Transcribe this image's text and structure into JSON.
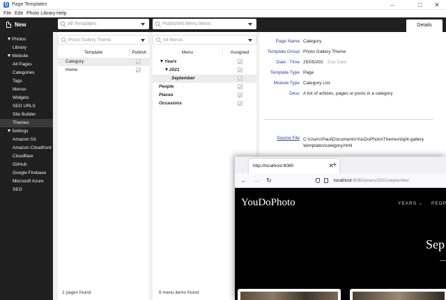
{
  "window": {
    "title": "Page Templates",
    "app_icon": "app-logo-icon"
  },
  "menubar": [
    "File",
    "Edit",
    "Photo Library",
    "Help"
  ],
  "toolbar": {
    "new_label": "New",
    "template_filter_placeholder": "All Templates",
    "menu_filter_placeholder": "Published Menu Items",
    "details_tab": "Details"
  },
  "sidebar": {
    "groups": [
      {
        "label": "Photos",
        "items": [
          "Library"
        ]
      },
      {
        "label": "Website",
        "items": [
          "All Pages",
          "Categories",
          "Tags",
          "Menus",
          "Widgets",
          "SEO URLS",
          "Site Builder",
          "Themes"
        ]
      },
      {
        "label": "Settings",
        "items": [
          "Amazon S3",
          "Amazon Cloudfront",
          "Cloudflare",
          "GitHub",
          "Google Firebase",
          "Microsoft Azure",
          "SEO"
        ]
      }
    ],
    "active_item": "Themes"
  },
  "templates_panel": {
    "search_placeholder": "Photo Gallery Theme",
    "columns": [
      "Template",
      "Publish"
    ],
    "rows": [
      {
        "name": "Category",
        "published": true,
        "selected": true
      },
      {
        "name": "Home",
        "published": true,
        "selected": false
      }
    ],
    "footer": "2 pages found"
  },
  "menus_panel": {
    "search_placeholder": "All Menus",
    "columns": [
      "Menu",
      "Assigned"
    ],
    "rows": [
      {
        "label": "Years",
        "level": 0,
        "expanded": true,
        "assigned": true
      },
      {
        "label": "2021",
        "level": 1,
        "expanded": true,
        "assigned": true
      },
      {
        "label": "September",
        "level": 2,
        "assigned": true,
        "selected": true
      },
      {
        "label": "People",
        "level": 0,
        "assigned": true
      },
      {
        "label": "Places",
        "level": 0,
        "assigned": true
      },
      {
        "label": "Occasions",
        "level": 0,
        "assigned": true
      }
    ],
    "footer": "6 menu items found"
  },
  "details": {
    "page_name_label": "Page Name",
    "page_name": "Category",
    "template_group_label": "Template Group",
    "template_group": "Photo Gallery Theme",
    "date_time_label": "Date - Time",
    "date": "25/05/202",
    "due_date_hint": "Due Date",
    "template_type_label": "Template Type",
    "template_type": "Page",
    "module_type_label": "Module Type",
    "module_type": "Category List",
    "desc_label": "Desc",
    "desc": "A list of articles, pages or posts in a category",
    "source_file_label": "Source File",
    "source_file_line1": "C:\\Users\\Paul\\Documents\\YouDoPhoto\\Themes\\light-gallery",
    "source_file_line2": "\\templates\\category.html"
  },
  "browser": {
    "tab_title": "http://localhost:8080",
    "url_host": "localhost",
    "url_path": ":8080/years/2021/september",
    "site_brand": "YouDoPhoto",
    "nav_years": "YEARS",
    "nav_people": "PEOP",
    "hero_text": "Sep"
  }
}
